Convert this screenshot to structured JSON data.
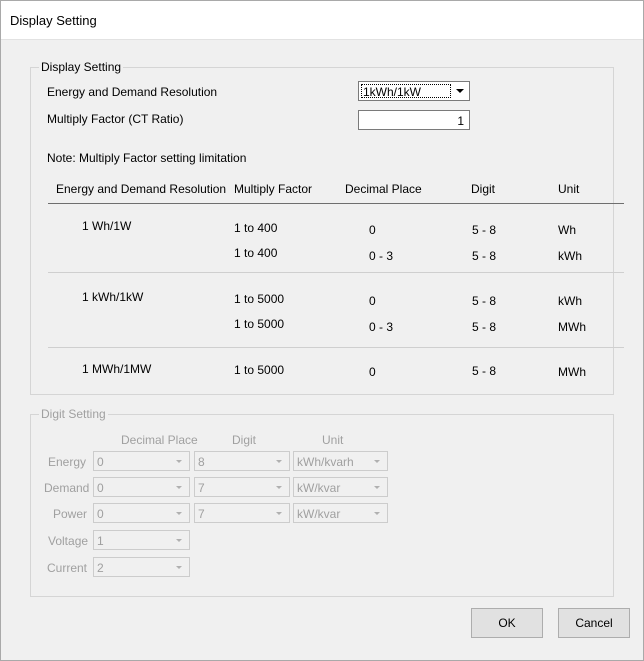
{
  "window": {
    "title": "Display Setting"
  },
  "display_group": {
    "legend": "Display Setting",
    "resolution_label": "Energy and Demand Resolution",
    "resolution_value": "1kWh/1kW",
    "multiply_label": "Multiply Factor (CT Ratio)",
    "multiply_value": "1",
    "note": "Note: Multiply Factor setting limitation",
    "table": {
      "headers": [
        "Energy and Demand Resolution",
        "Multiply Factor",
        "Decimal Place",
        "Digit",
        "Unit"
      ],
      "groups": [
        {
          "resolution": "1 Wh/1W",
          "rows": [
            {
              "factor": "1 to 400",
              "decimal": "0",
              "digit": "5 - 8",
              "unit": "Wh"
            },
            {
              "factor": "1 to 400",
              "decimal": "0 - 3",
              "digit": "5 - 8",
              "unit": "kWh"
            }
          ]
        },
        {
          "resolution": "1 kWh/1kW",
          "rows": [
            {
              "factor": "1 to 5000",
              "decimal": "0",
              "digit": "5 - 8",
              "unit": "kWh"
            },
            {
              "factor": "1 to 5000",
              "decimal": "0 - 3",
              "digit": "5 - 8",
              "unit": "MWh"
            }
          ]
        },
        {
          "resolution": "1 MWh/1MW",
          "rows": [
            {
              "factor": "1 to 5000",
              "decimal": "0",
              "digit": "5 - 8",
              "unit": "MWh"
            }
          ]
        }
      ]
    }
  },
  "digit_group": {
    "legend": "Digit Setting",
    "headers": {
      "decimal": "Decimal Place",
      "digit": "Digit",
      "unit": "Unit"
    },
    "rows": [
      {
        "label": "Energy",
        "decimal": "0",
        "digit": "8",
        "unit": "kWh/kvarh"
      },
      {
        "label": "Demand",
        "decimal": "0",
        "digit": "7",
        "unit": "kW/kvar"
      },
      {
        "label": "Power",
        "decimal": "0",
        "digit": "7",
        "unit": "kW/kvar"
      },
      {
        "label": "Voltage",
        "decimal": "1"
      },
      {
        "label": "Current",
        "decimal": "2"
      }
    ]
  },
  "buttons": {
    "ok": "OK",
    "cancel": "Cancel"
  }
}
